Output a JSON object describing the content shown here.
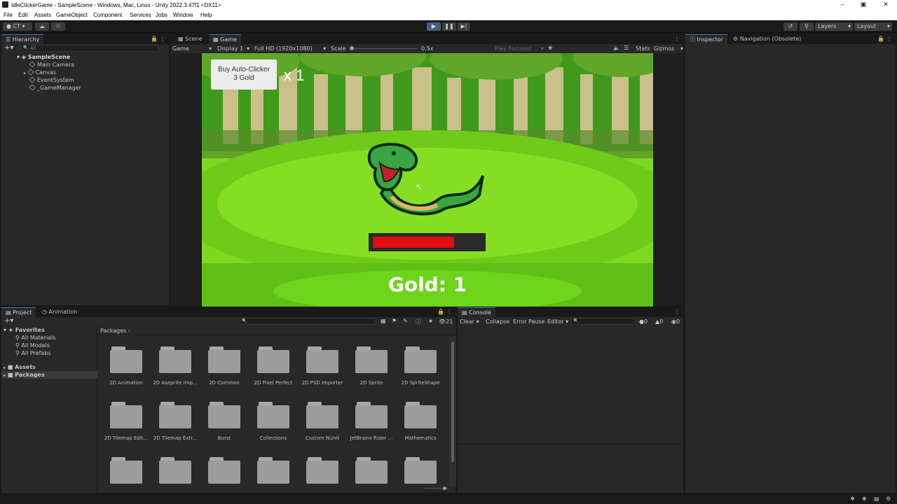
{
  "window": {
    "title": "IdleClickerGame - SampleScene - Windows, Mac, Linux - Unity 2022.3.47f1 <DX11>"
  },
  "menu": [
    "File",
    "Edit",
    "Assets",
    "GameObject",
    "Component",
    "Services",
    "Jobs",
    "Window",
    "Help"
  ],
  "toolbar": {
    "account": "CT",
    "layers": "Layers",
    "layout": "Layout"
  },
  "hierarchy": {
    "tab": "Hierarchy",
    "search_placeholder": "All",
    "scene": "SampleScene",
    "items": [
      "Main Camera",
      "Canvas",
      "EventSystem",
      "_GameManager"
    ]
  },
  "center": {
    "tabs": [
      "Scene",
      "Game"
    ],
    "game_mode": "Game",
    "display": "Display 1",
    "resolution": "Full HD (1920x1080)",
    "scale_label": "Scale",
    "scale_value": "0.5x",
    "play_focused": "Play Focused",
    "stats": "Stats",
    "gizmos": "Gizmos"
  },
  "game": {
    "buy_button_line1": "Buy Auto-Clicker",
    "buy_button_line2": "3 Gold",
    "multiplier": "x 1",
    "gold_label": "Gold: 1",
    "health_fraction": 0.75,
    "colors": {
      "health_fill": "#e00d0d",
      "sky": "#3f9a1c",
      "grass": "#7fd81f"
    }
  },
  "inspector": {
    "tabs": [
      "Inspector",
      "Navigation (Obsolete)"
    ]
  },
  "project": {
    "tabs": [
      "Project",
      "Animation"
    ],
    "favorites": "Favorites",
    "favorite_items": [
      "All Materials",
      "All Models",
      "All Prefabs"
    ],
    "roots": [
      "Assets",
      "Packages"
    ],
    "breadcrumb": "Packages",
    "hidden_count": "21",
    "folders": [
      "2D Animation",
      "2D Aseprite Imp...",
      "2D Common",
      "2D Pixel Perfect",
      "2D PSD Importer",
      "2D Sprite",
      "2D SpriteShape",
      "2D Tilemap Edit...",
      "2D Tilemap Extr...",
      "Burst",
      "Collections",
      "Custom NUnit",
      "JetBrains Rider ...",
      "Mathematics",
      "",
      "",
      "",
      "",
      "",
      "",
      ""
    ]
  },
  "console": {
    "tab": "Console",
    "clear": "Clear",
    "collapse": "Collapse",
    "error_pause": "Error Pause",
    "editor": "Editor",
    "counts": [
      "0",
      "0",
      "0"
    ]
  }
}
